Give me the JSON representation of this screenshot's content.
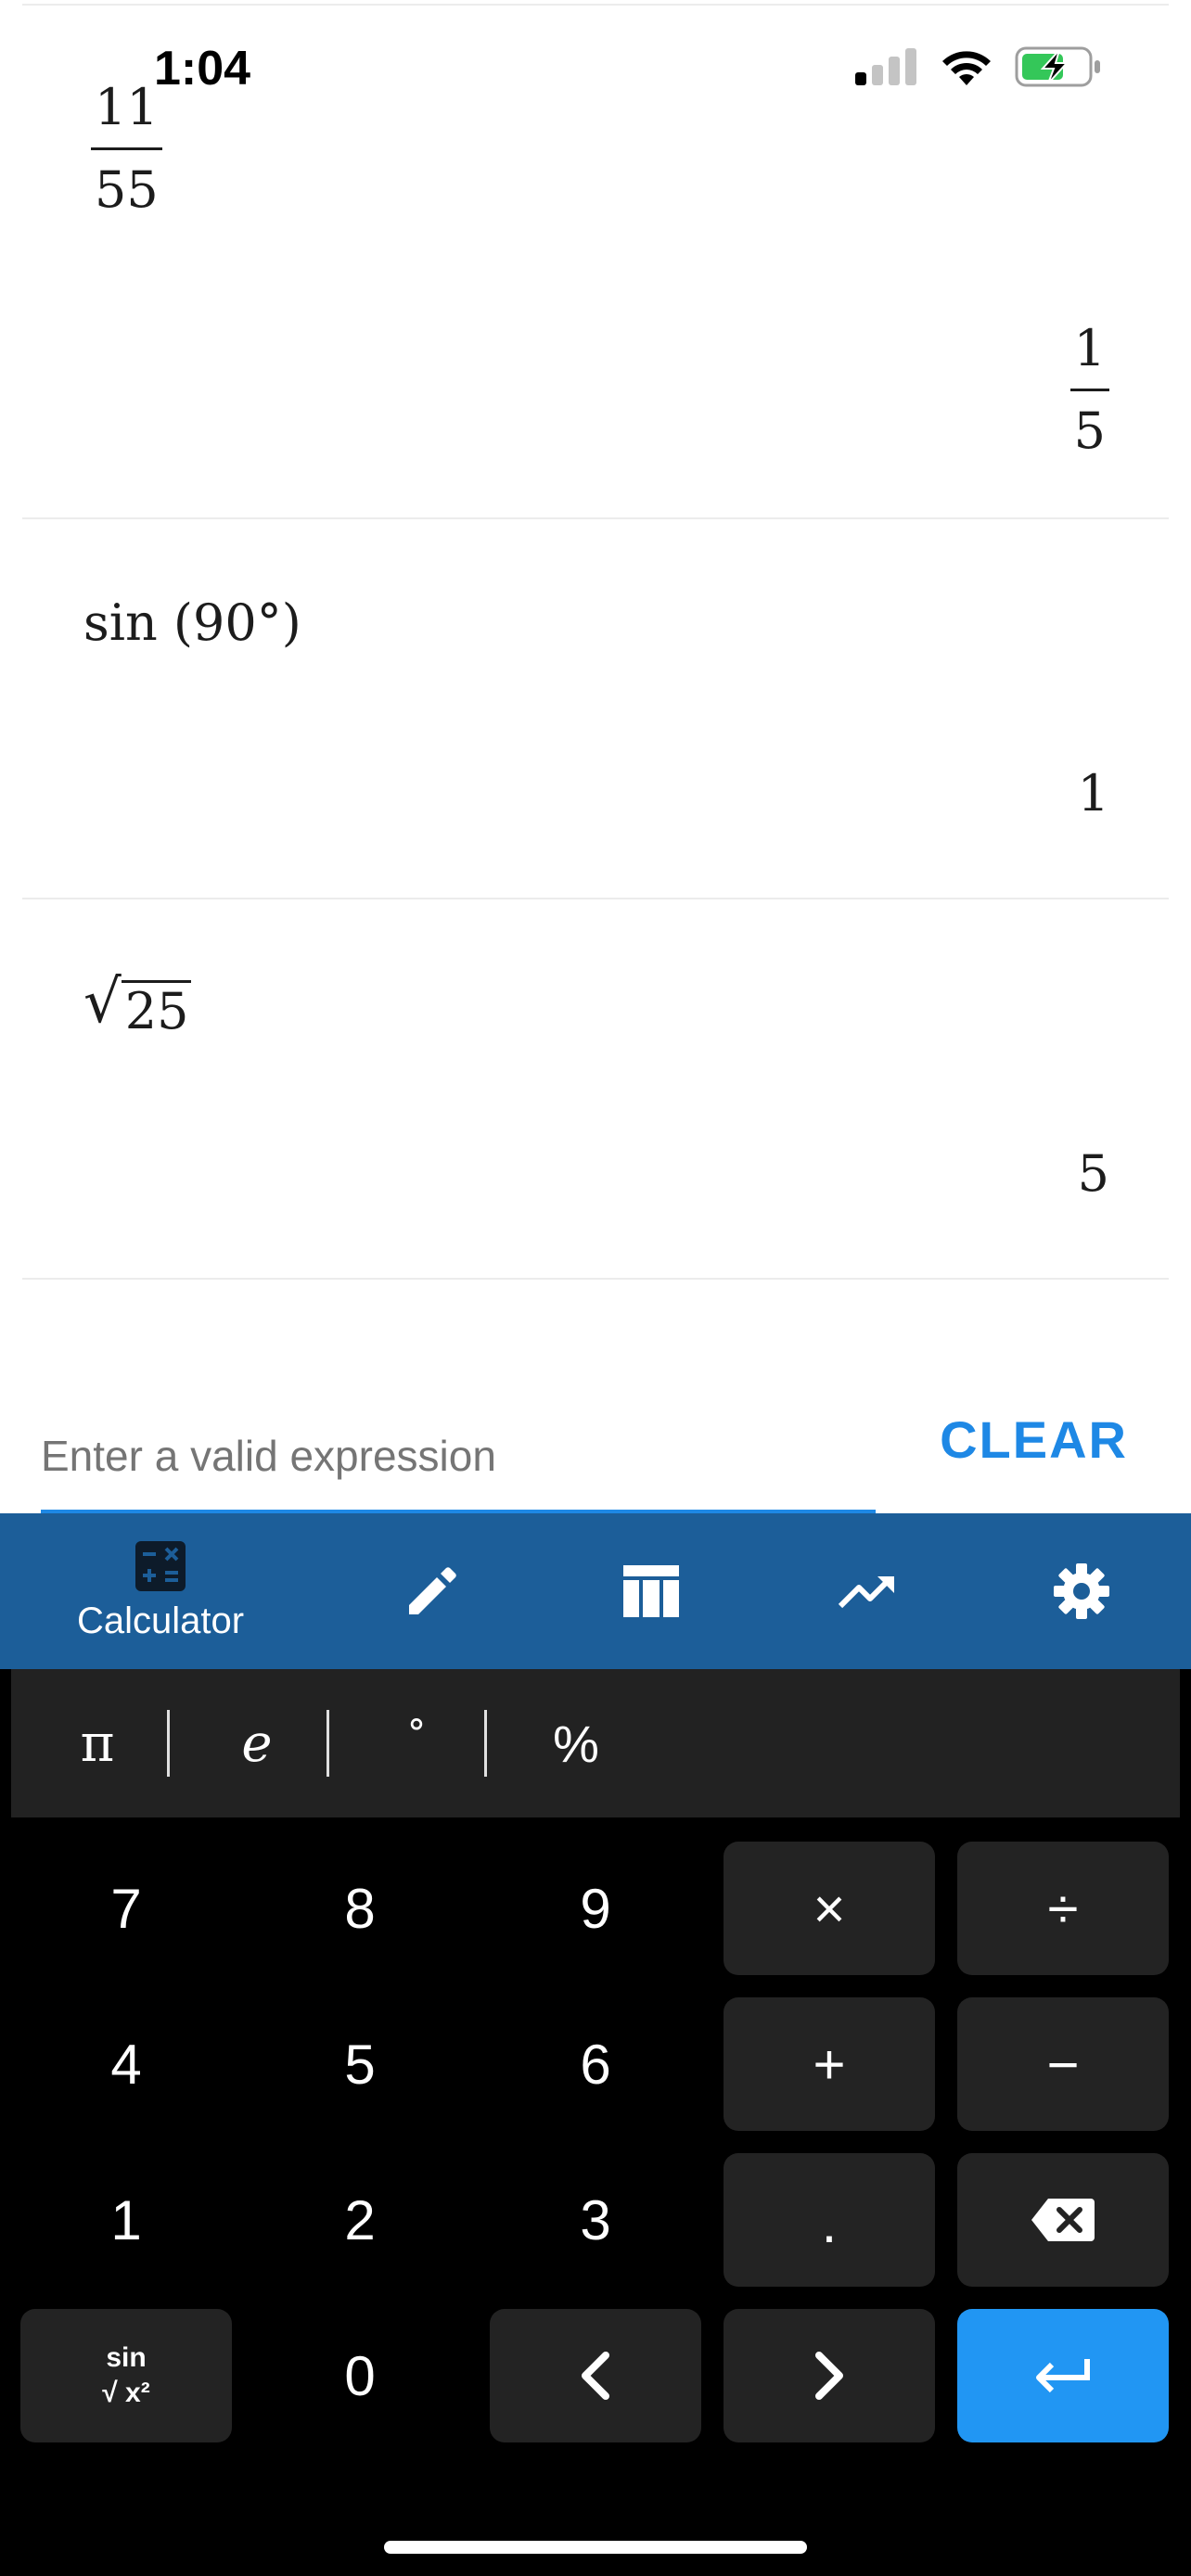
{
  "status_bar": {
    "time": "1:04"
  },
  "history": [
    {
      "expr_num": "11",
      "expr_den": "55",
      "result_num": "1",
      "result_den": "5"
    },
    {
      "expr": "sin (90°)",
      "result": "1"
    },
    {
      "expr_radicand": "25",
      "result": "5"
    }
  ],
  "input": {
    "placeholder": "Enter a valid expression",
    "value": ""
  },
  "clear_label": "CLEAR",
  "nav": {
    "calculator_label": "Calculator",
    "items": [
      "calculator-icon",
      "pencil-icon",
      "table-icon",
      "trend-chart-icon",
      "gear-icon"
    ]
  },
  "constants": [
    "π",
    "e",
    "°",
    "%"
  ],
  "keys": {
    "row1": [
      "7",
      "8",
      "9",
      "×",
      "÷"
    ],
    "row2": [
      "4",
      "5",
      "6",
      "+",
      "−"
    ],
    "row3": [
      "1",
      "2",
      "3",
      "."
    ],
    "row4": [
      "0"
    ],
    "func_key": {
      "top": "sin",
      "bottom": "√ x²"
    }
  },
  "colors": {
    "accent": "#2196f3",
    "nav_bg": "#1c5e99",
    "key_bg": "#232323",
    "const_bar_bg": "#222222"
  }
}
